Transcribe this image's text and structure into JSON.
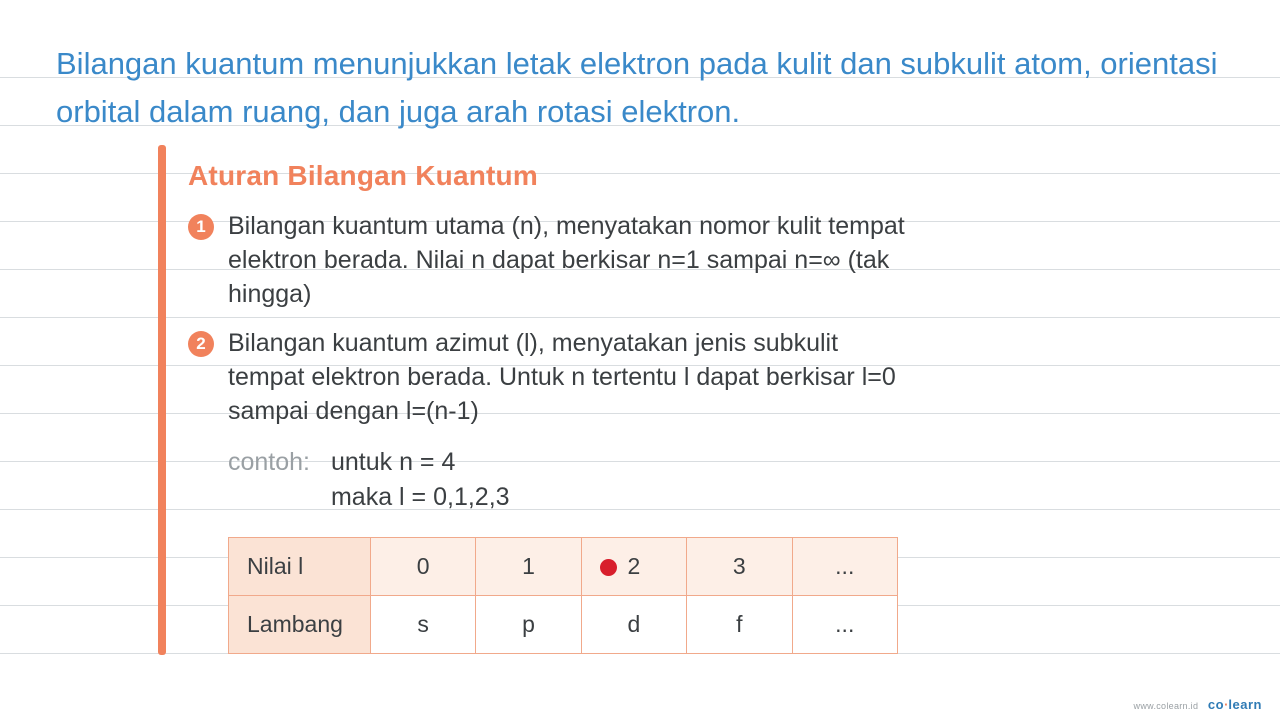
{
  "title": "Bilangan kuantum menunjukkan letak elektron pada kulit dan subkulit atom, orientasi orbital dalam ruang, dan juga arah rotasi elektron.",
  "section_heading": "Aturan Bilangan Kuantum",
  "items": [
    {
      "num": "1",
      "text": "Bilangan kuantum utama (n), menyatakan nomor kulit tempat elektron berada. Nilai n dapat berkisar n=1 sampai n=∞ (tak hingga)"
    },
    {
      "num": "2",
      "text": "Bilangan kuantum azimut (l), menyatakan jenis subkulit tempat elektron berada. Untuk n tertentu l dapat berkisar l=0 sampai dengan l=(n-1)"
    }
  ],
  "example": {
    "label": "contoh:",
    "line1": "untuk n = 4",
    "line2": "maka l = 0,1,2,3"
  },
  "table": {
    "row1_label": "Nilai l",
    "row2_label": "Lambang",
    "cols": [
      {
        "val": "0",
        "sym": "s"
      },
      {
        "val": "1",
        "sym": "p"
      },
      {
        "val": "2",
        "sym": "d"
      },
      {
        "val": "3",
        "sym": "f"
      },
      {
        "val": "...",
        "sym": "..."
      }
    ]
  },
  "brand": {
    "site": "www.colearn.id",
    "name_a": "co",
    "dot": "·",
    "name_b": "learn"
  }
}
